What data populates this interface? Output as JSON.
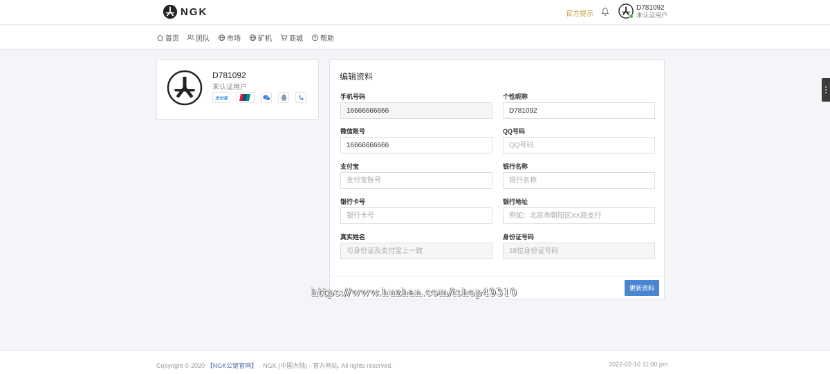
{
  "header": {
    "logo_text": "NGK",
    "notice_link": "官方提示",
    "user_id": "D781092",
    "user_status": "未认证用户"
  },
  "nav": {
    "items": [
      {
        "label": "首页",
        "icon": "home-icon"
      },
      {
        "label": "团队",
        "icon": "users-icon"
      },
      {
        "label": "市场",
        "icon": "globe-icon"
      },
      {
        "label": "矿机",
        "icon": "globe-icon"
      },
      {
        "label": "商城",
        "icon": "cart-icon"
      },
      {
        "label": "帮助",
        "icon": "help-icon"
      }
    ]
  },
  "profile": {
    "user_id": "D781092",
    "status": "未认证用户",
    "bind_icons": [
      "alipay-icon",
      "unionpay-icon",
      "wechat-icon",
      "qq-icon",
      "phone-icon"
    ],
    "alipay_text": "支付宝"
  },
  "form": {
    "title": "编辑资料",
    "fields": [
      {
        "label": "手机号码",
        "value": "16666666666",
        "placeholder": "",
        "readonly": true
      },
      {
        "label": "个性昵称",
        "value": "D781092",
        "placeholder": "",
        "readonly": false
      },
      {
        "label": "微信账号",
        "value": "16666666666",
        "placeholder": "",
        "readonly": false
      },
      {
        "label": "QQ号码",
        "value": "",
        "placeholder": "QQ号码",
        "readonly": false
      },
      {
        "label": "支付宝",
        "value": "",
        "placeholder": "支付宝账号",
        "readonly": false
      },
      {
        "label": "银行名称",
        "value": "",
        "placeholder": "银行名称",
        "readonly": false
      },
      {
        "label": "银行卡号",
        "value": "",
        "placeholder": "银行卡号",
        "readonly": false
      },
      {
        "label": "银行地址",
        "value": "",
        "placeholder": "例如：北京市朝阳区XX路支行",
        "readonly": false
      },
      {
        "label": "真实姓名",
        "value": "",
        "placeholder": "与身份证及支付宝上一致",
        "readonly": true
      },
      {
        "label": "身份证号码",
        "value": "",
        "placeholder": "18位身份证号码",
        "readonly": true
      }
    ],
    "submit_label": "更新资料"
  },
  "watermark": "https://www.huzhan.com/ishop49310",
  "footer": {
    "copyright_prefix": "Copyright © 2020",
    "brand": "【NGK公链官网】",
    "copyright_suffix": " - NGK (中国大陆) - 官方网站. All rights reserved.",
    "timestamp": "2022-02-10 11:00 pm"
  },
  "colors": {
    "accent": "#4a86d0",
    "notice": "#c9a14a",
    "online": "#44b549",
    "page_bg": "#f4f5f8"
  }
}
